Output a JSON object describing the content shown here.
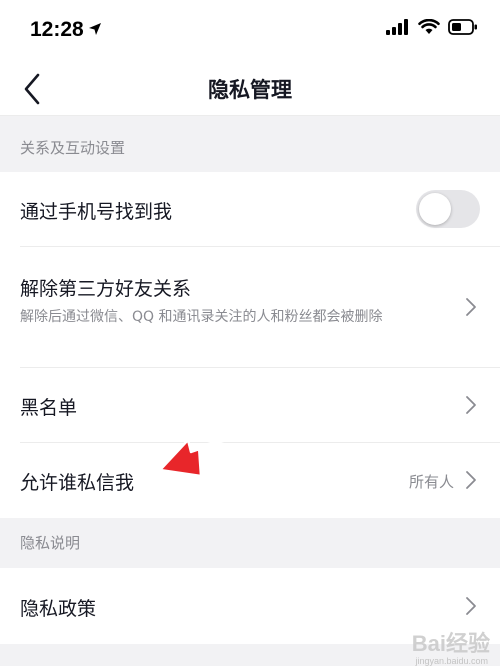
{
  "status_bar": {
    "time": "12:28",
    "icons": [
      "location-arrow-icon",
      "cellular-signal-icon",
      "wifi-icon",
      "battery-icon"
    ]
  },
  "nav": {
    "title": "隐私管理",
    "back_icon": "chevron-left-icon"
  },
  "sections": {
    "relations": {
      "header": "关系及互动设置",
      "rows": {
        "find_by_phone": {
          "label": "通过手机号找到我",
          "toggle_on": false
        },
        "third_party": {
          "label": "解除第三方好友关系",
          "desc": "解除后通过微信、QQ 和通讯录关注的人和粉丝都会被删除"
        },
        "blacklist": {
          "label": "黑名单"
        },
        "who_can_message": {
          "label": "允许谁私信我",
          "value": "所有人"
        }
      }
    },
    "privacy": {
      "header": "隐私说明",
      "rows": {
        "policy": {
          "label": "隐私政策"
        }
      }
    }
  },
  "colors": {
    "annotation_arrow": "#e8262a",
    "toggle_off": "#e5e5e8",
    "secondary_text": "#8a8b91"
  },
  "watermark": {
    "brand": "Bai经验",
    "sub": "jingyan.baidu.com"
  }
}
